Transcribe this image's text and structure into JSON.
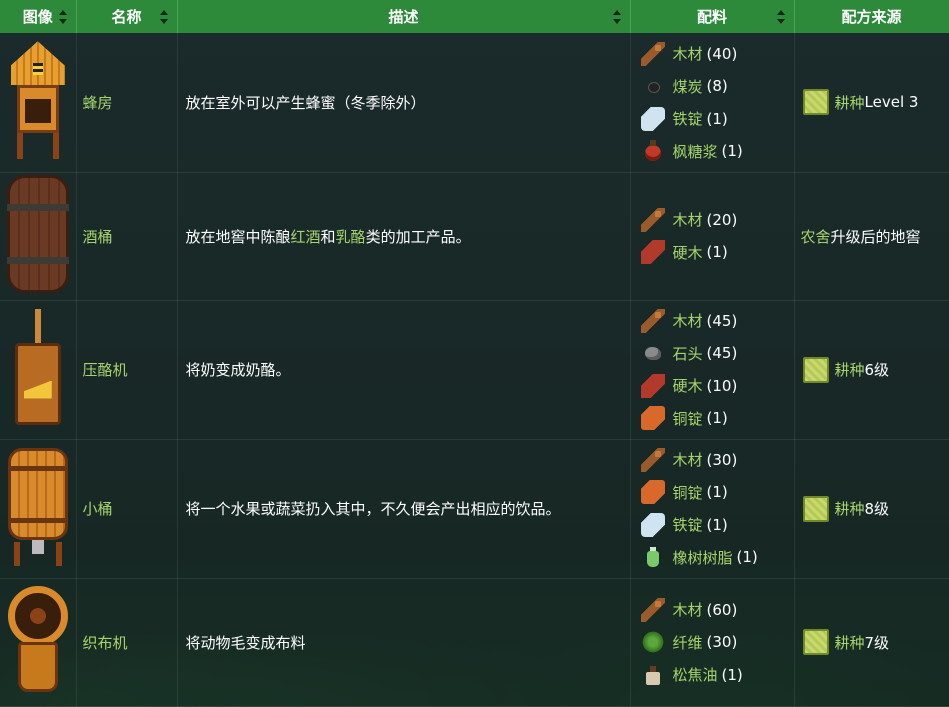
{
  "headers": [
    "图像",
    "名称",
    "描述",
    "配料",
    "配方来源"
  ],
  "rows": [
    {
      "name": "蜂房",
      "desc": "放在室外可以产生蜂蜜（冬季除外）",
      "ingredients": [
        {
          "icon": "wood-icon",
          "name": "木材",
          "count": "(40)"
        },
        {
          "icon": "coal-icon",
          "name": "煤炭",
          "count": "(8)"
        },
        {
          "icon": "iron-bar-icon",
          "name": "铁锭",
          "count": "(1)"
        },
        {
          "icon": "maple-syrup-icon",
          "name": "枫糖浆",
          "count": "(1)"
        }
      ],
      "source": {
        "link": "耕种",
        "text": " Level 3"
      }
    },
    {
      "name": "酒桶",
      "desc": {
        "pre": "放在地窖中陈酿",
        "hl1": "红酒",
        "mid": "和",
        "hl2": "乳酪",
        "post": "类的加工产品。"
      },
      "ingredients": [
        {
          "icon": "wood-icon",
          "name": "木材",
          "count": "(20)"
        },
        {
          "icon": "hardwood-icon",
          "name": "硬木",
          "count": "(1)"
        }
      ],
      "source": {
        "link": "农舍",
        "text": "升级后的地窖"
      }
    },
    {
      "name": "压酪机",
      "desc": "将奶变成奶酪。",
      "ingredients": [
        {
          "icon": "wood-icon",
          "name": "木材",
          "count": "(45)"
        },
        {
          "icon": "stone-icon",
          "name": "石头",
          "count": "(45)"
        },
        {
          "icon": "hardwood-icon",
          "name": "硬木",
          "count": "(10)"
        },
        {
          "icon": "copper-bar-icon",
          "name": "铜锭",
          "count": "(1)"
        }
      ],
      "source": {
        "link": "耕种",
        "text": "6级"
      }
    },
    {
      "name": "小桶",
      "desc": "将一个水果或蔬菜扔入其中，不久便会产出相应的饮品。",
      "ingredients": [
        {
          "icon": "wood-icon",
          "name": "木材",
          "count": "(30)"
        },
        {
          "icon": "copper-bar-icon",
          "name": "铜锭",
          "count": "(1)"
        },
        {
          "icon": "iron-bar-icon",
          "name": "铁锭",
          "count": "(1)"
        },
        {
          "icon": "oak-resin-icon",
          "name": "橡树树脂",
          "count": "(1)"
        }
      ],
      "source": {
        "link": "耕种",
        "text": "8级"
      }
    },
    {
      "name": "织布机",
      "desc": "将动物毛变成布料",
      "ingredients": [
        {
          "icon": "wood-icon",
          "name": "木材",
          "count": "(60)"
        },
        {
          "icon": "fiber-icon",
          "name": "纤维",
          "count": "(30)"
        },
        {
          "icon": "pine-tar-icon",
          "name": "松焦油",
          "count": "(1)"
        }
      ],
      "source": {
        "link": "耕种",
        "text": "7级"
      }
    }
  ]
}
